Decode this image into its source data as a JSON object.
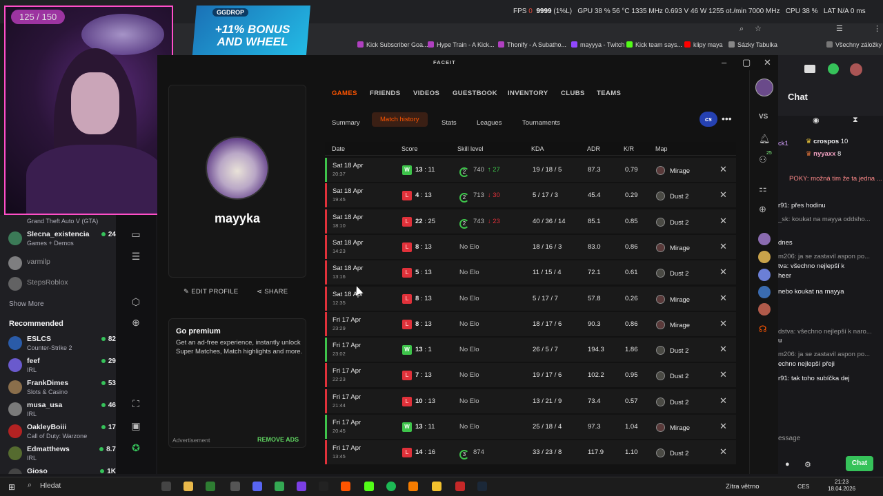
{
  "os": {
    "fps_line": "FPS",
    "fps_value": "9999",
    "fps_pct": "(1%L)",
    "gpu": "GPU 38 % 56 °C 1335 MHz 0.693 V 46 W 1255 ot./min 7000 MHz",
    "cpu": "CPU 38 %",
    "lat": "LAT N/A 0 ms"
  },
  "ggdrop": {
    "brand": "GGDROP",
    "promo": "+11% BONUS AND WHEEL"
  },
  "webcam": {
    "viewers": "125 / 150"
  },
  "bookmarks": [
    "Kick Subscriber Goa...",
    "Hype Train - A Kick...",
    "Thonify - A Subatho...",
    "mayyya - Twitch",
    "Kick team says...",
    "klipy maya",
    "Sázky Tabulka",
    "Všechny záložky"
  ],
  "twitch_sidebar": {
    "partial_game": "Grand Theft Auto V (GTA)",
    "followed": [
      {
        "name": "Slecna_existencia",
        "game": "Games + Demos",
        "viewers": "24"
      },
      {
        "name": "varmilp",
        "game": "",
        "viewers": ""
      },
      {
        "name": "StepsRoblox",
        "game": "",
        "viewers": ""
      }
    ],
    "show_more": "Show More",
    "recommended_title": "Recommended",
    "recommended": [
      {
        "name": "ESLCS",
        "game": "Counter-Strike 2",
        "viewers": "82"
      },
      {
        "name": "feef",
        "game": "IRL",
        "viewers": "29"
      },
      {
        "name": "FrankDimes",
        "game": "Slots & Casino",
        "viewers": "53"
      },
      {
        "name": "musa_usa",
        "game": "IRL",
        "viewers": "46"
      },
      {
        "name": "OakleyBoiii",
        "game": "Call of Duty: Warzone",
        "viewers": "17"
      },
      {
        "name": "Edmatthews",
        "game": "IRL",
        "viewers": "8.7"
      },
      {
        "name": "Gioso",
        "game": "",
        "viewers": "1K"
      }
    ]
  },
  "faceit": {
    "logo": "FACEIT",
    "username": "mayyka",
    "edit_profile": "EDIT PROFILE",
    "share": "SHARE",
    "premium_title": "Go premium",
    "premium_body": "Get an ad-free experience, instantly unlock Super Matches, Match highlights and more.",
    "advertisement": "Advertisement",
    "remove_ads": "REMOVE ADS",
    "tabs": [
      "GAMES",
      "FRIENDS",
      "VIDEOS",
      "GUESTBOOK",
      "INVENTORY",
      "CLUBS",
      "TEAMS"
    ],
    "subtabs": [
      "Summary",
      "Match history",
      "Stats",
      "Leagues",
      "Tournaments"
    ],
    "game_badge": "cs",
    "columns": [
      "Date",
      "Score",
      "Skill level",
      "KDA",
      "ADR",
      "K/R",
      "Map"
    ],
    "matches": [
      {
        "date": "Sat 18 Apr",
        "time": "20:37",
        "result": "W",
        "score_a": "13",
        "score_b": "11",
        "level": "2",
        "elo": "740",
        "delta": "27",
        "dir": "up",
        "kda": "19 / 18 / 5",
        "adr": "87.3",
        "kr": "0.79",
        "map": "Mirage"
      },
      {
        "date": "Sat 18 Apr",
        "time": "19:45",
        "result": "L",
        "score_a": "4",
        "score_b": "13",
        "level": "2",
        "elo": "713",
        "delta": "30",
        "dir": "down",
        "kda": "5 / 17 / 3",
        "adr": "45.4",
        "kr": "0.29",
        "map": "Dust 2"
      },
      {
        "date": "Sat 18 Apr",
        "time": "18:10",
        "result": "L",
        "score_a": "22",
        "score_b": "25",
        "level": "2",
        "elo": "743",
        "delta": "23",
        "dir": "down",
        "kda": "40 / 36 / 14",
        "adr": "85.1",
        "kr": "0.85",
        "map": "Dust 2"
      },
      {
        "date": "Sat 18 Apr",
        "time": "14:23",
        "result": "L",
        "score_a": "8",
        "score_b": "13",
        "level": "",
        "elo": "No Elo",
        "delta": "",
        "dir": "",
        "kda": "18 / 16 / 3",
        "adr": "83.0",
        "kr": "0.86",
        "map": "Mirage"
      },
      {
        "date": "Sat 18 Apr",
        "time": "13:16",
        "result": "L",
        "score_a": "5",
        "score_b": "13",
        "level": "",
        "elo": "No Elo",
        "delta": "",
        "dir": "",
        "kda": "11 / 15 / 4",
        "adr": "72.1",
        "kr": "0.61",
        "map": "Dust 2"
      },
      {
        "date": "Sat 18 Apr",
        "time": "12:35",
        "result": "L",
        "score_a": "8",
        "score_b": "13",
        "level": "",
        "elo": "No Elo",
        "delta": "",
        "dir": "",
        "kda": "5 / 17 / 7",
        "adr": "57.8",
        "kr": "0.26",
        "map": "Mirage"
      },
      {
        "date": "Fri 17 Apr",
        "time": "23:29",
        "result": "L",
        "score_a": "8",
        "score_b": "13",
        "level": "",
        "elo": "No Elo",
        "delta": "",
        "dir": "",
        "kda": "18 / 17 / 6",
        "adr": "90.3",
        "kr": "0.86",
        "map": "Mirage"
      },
      {
        "date": "Fri 17 Apr",
        "time": "23:02",
        "result": "W",
        "score_a": "13",
        "score_b": "1",
        "level": "",
        "elo": "No Elo",
        "delta": "",
        "dir": "",
        "kda": "26 / 5 / 7",
        "adr": "194.3",
        "kr": "1.86",
        "map": "Dust 2"
      },
      {
        "date": "Fri 17 Apr",
        "time": "22:23",
        "result": "L",
        "score_a": "7",
        "score_b": "13",
        "level": "",
        "elo": "No Elo",
        "delta": "",
        "dir": "",
        "kda": "19 / 17 / 6",
        "adr": "102.2",
        "kr": "0.95",
        "map": "Dust 2"
      },
      {
        "date": "Fri 17 Apr",
        "time": "21:44",
        "result": "L",
        "score_a": "10",
        "score_b": "13",
        "level": "",
        "elo": "No Elo",
        "delta": "",
        "dir": "",
        "kda": "13 / 21 / 9",
        "adr": "73.4",
        "kr": "0.57",
        "map": "Dust 2"
      },
      {
        "date": "Fri 17 Apr",
        "time": "20:45",
        "result": "W",
        "score_a": "13",
        "score_b": "11",
        "level": "",
        "elo": "No Elo",
        "delta": "",
        "dir": "",
        "kda": "25 / 18 / 4",
        "adr": "97.3",
        "kr": "1.04",
        "map": "Mirage"
      },
      {
        "date": "Fri 17 Apr",
        "time": "13:45",
        "result": "L",
        "score_a": "14",
        "score_b": "16",
        "level": "3",
        "elo": "874",
        "delta": "",
        "dir": "",
        "kda": "33 / 23 / 8",
        "adr": "117.9",
        "kr": "1.10",
        "map": "Dust 2"
      }
    ],
    "right_vs": "VS",
    "notif_count": "25"
  },
  "chat": {
    "title": "Chat",
    "leaders": [
      {
        "name": "crospos",
        "value": "10"
      },
      {
        "name": "nyyaxx",
        "value": "8"
      }
    ],
    "lines": [
      "ck1",
      "POKY: možná tim že ta jedna ...",
      "r91: přes hodinu",
      "_sk: koukat na mayya oddsho...",
      "dnes",
      "m206: ja se zastavil aspon po...",
      "tva: všechno nejlepší k",
      "heer",
      "nebo koukat na mayya",
      "dstva: všechno nejlepší k naro...",
      "u",
      "m206: ja se zastavil aspon po...",
      "echno nejlepší přeji",
      "r91: tak toho subíčka dej"
    ],
    "input_placeholder": "essage",
    "chat_button": "Chat"
  },
  "taskbar": {
    "search": "Hledat",
    "weather": "Zítra větrno",
    "lang": "CES",
    "time": "21:23",
    "date": "18.04.2026"
  }
}
